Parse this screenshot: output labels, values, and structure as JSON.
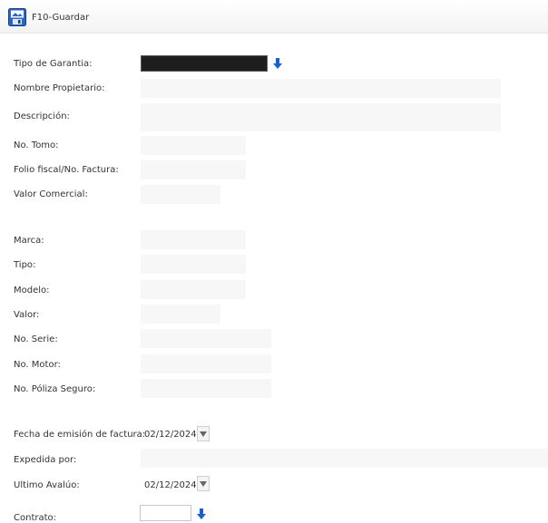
{
  "toolbar": {
    "save_label": "F10-Guardar",
    "save_icon": "save-icon"
  },
  "form": {
    "tipo_garantia_label": "Tipo de Garantia:",
    "nombre_propietario_label": "Nombre Propietario:",
    "descripcion_label": "Descripción:",
    "no_tomo_label": "No. Tomo:",
    "folio_label": "Folio fiscal/No. Factura:",
    "valor_comercial_label": "Valor Comercial:",
    "marca_label": "Marca:",
    "tipo_label": "Tipo:",
    "modelo_label": "Modelo:",
    "valor_label": "Valor:",
    "no_serie_label": "No. Serie:",
    "no_motor_label": "No. Motor:",
    "no_poliza_label": "No. Póliza Seguro:",
    "fecha_emision_label": "Fecha de emisión de factura:",
    "fecha_emision_value": "02/12/2024",
    "expedida_por_label": "Expedida por:",
    "ultimo_avaluo_label": "Ultimo Avalúo:",
    "ultimo_avaluo_value": "02/12/2024",
    "contrato_label": "Contrato:"
  },
  "colors": {
    "accent_blue": "#1a5fd6",
    "field_bg": "#f7f7f7",
    "select_dark": "#1e1e1e"
  }
}
